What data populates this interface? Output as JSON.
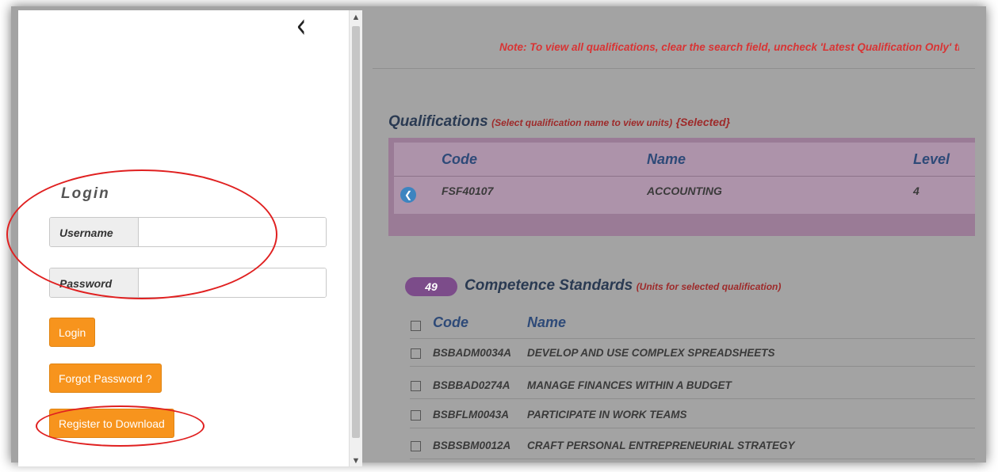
{
  "note": "Note: To view all qualifications, clear the search field, uncheck 'Latest Qualification Only' th",
  "login": {
    "heading": "Login",
    "username_label": "Username",
    "username_value": "",
    "password_label": "Password",
    "password_value": "",
    "login_button": "Login",
    "forgot_button": "Forgot Password ?",
    "register_button": "Register to Download"
  },
  "qualifications": {
    "title": "Qualifications",
    "hint": "(Select qualification name to view units)",
    "selected_tag": "{Selected}",
    "columns": {
      "code": "Code",
      "name": "Name",
      "level": "Level"
    },
    "row": {
      "code": "FSF40107",
      "name": "ACCOUNTING",
      "level": "4"
    }
  },
  "competence": {
    "count": "49",
    "title": "Competence Standards",
    "hint": "(Units for selected qualification)",
    "columns": {
      "code": "Code",
      "name": "Name"
    },
    "units": [
      {
        "code": "BSBADM0034A",
        "name": "DEVELOP AND USE COMPLEX SPREADSHEETS"
      },
      {
        "code": "BSBBAD0274A",
        "name": "MANAGE FINANCES WITHIN A BUDGET"
      },
      {
        "code": "BSBFLM0043A",
        "name": "PARTICIPATE IN WORK TEAMS"
      },
      {
        "code": "BSBSBM0012A",
        "name": "CRAFT PERSONAL ENTREPRENEURIAL STRATEGY"
      }
    ]
  },
  "colors": {
    "accent_orange": "#f7941d",
    "annotation_red": "#e02020",
    "selected_row": "#ad93aa",
    "badge_purple": "#7c4c8a"
  },
  "icons": [
    "chevron-left-icon",
    "scroll-up-icon",
    "scroll-down-icon",
    "back-circle-icon"
  ]
}
